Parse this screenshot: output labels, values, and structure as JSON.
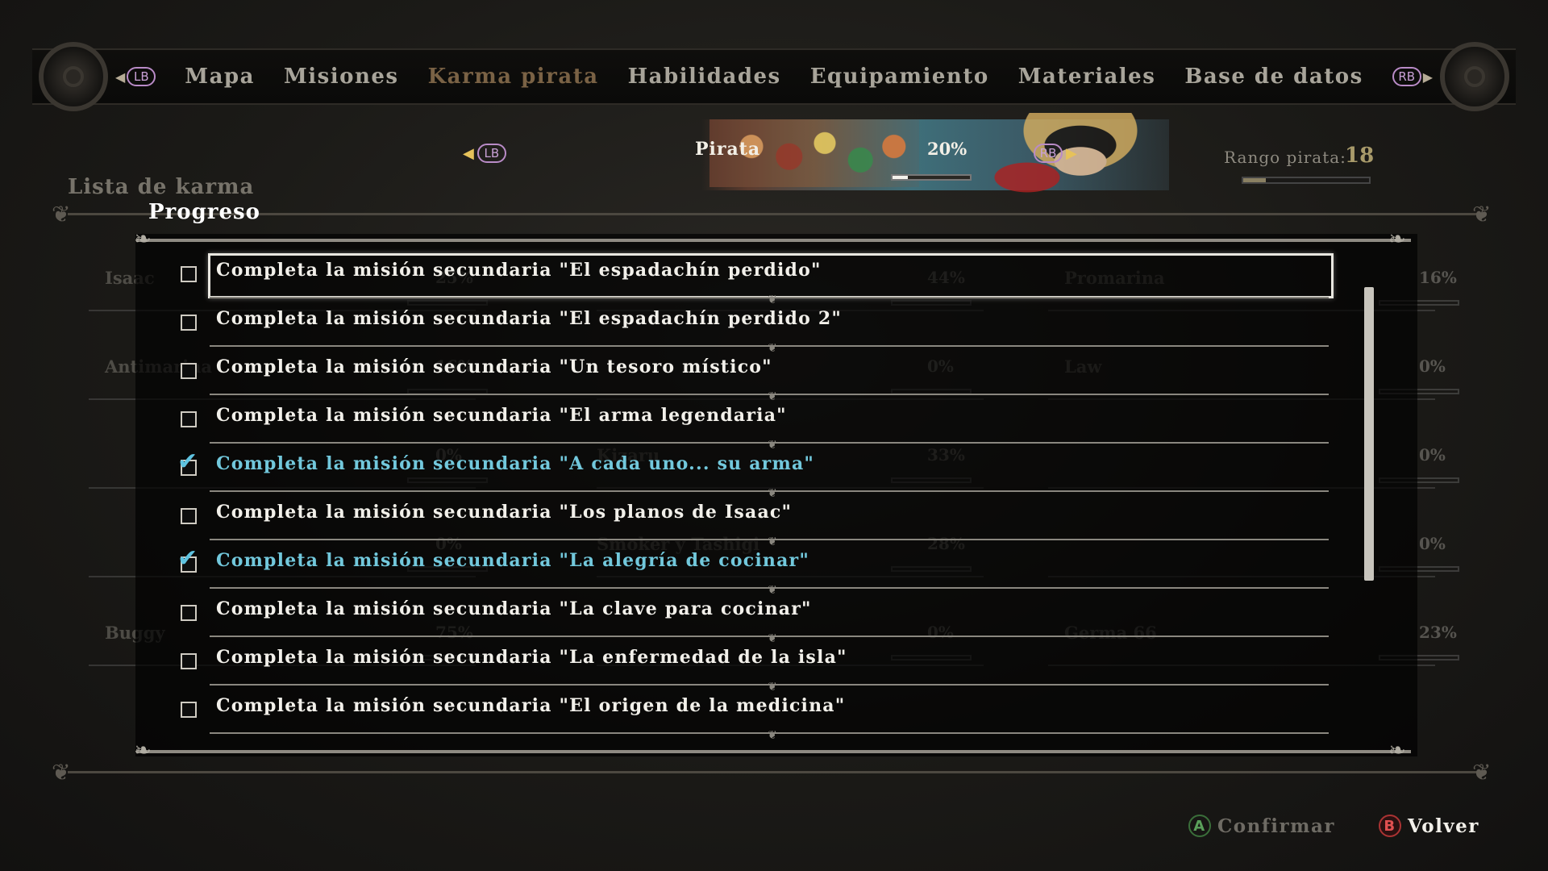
{
  "top_nav": {
    "left_button": "LB",
    "right_button": "RB",
    "tabs": [
      {
        "label": "Mapa",
        "active": false
      },
      {
        "label": "Misiones",
        "active": false
      },
      {
        "label": "Karma pirata",
        "active": true
      },
      {
        "label": "Habilidades",
        "active": false
      },
      {
        "label": "Equipamiento",
        "active": false
      },
      {
        "label": "Materiales",
        "active": false
      },
      {
        "label": "Base de datos",
        "active": false
      }
    ]
  },
  "category": {
    "prev_button": "LB",
    "next_button": "RB",
    "name": "Pirata",
    "percent": "20%",
    "progress": 0.2
  },
  "rank": {
    "label": "Rango pirata:",
    "value": "18",
    "progress": 0.18
  },
  "list_title": "Lista de karma",
  "background_grid": [
    {
      "name": "Isaac",
      "percent": "25%"
    },
    {
      "name": "",
      "percent": "44%"
    },
    {
      "name": "Promarina",
      "percent": "16%"
    },
    {
      "name": "Antimarina",
      "percent": "16%"
    },
    {
      "name": "",
      "percent": "0%"
    },
    {
      "name": "Law",
      "percent": "0%"
    },
    {
      "name": "",
      "percent": "0%"
    },
    {
      "name": "Kizaru",
      "percent": "33%"
    },
    {
      "name": "",
      "percent": "0%"
    },
    {
      "name": "",
      "percent": "0%"
    },
    {
      "name": "Smoker y Tashigi",
      "percent": "28%"
    },
    {
      "name": "",
      "percent": "0%"
    },
    {
      "name": "Buggy",
      "percent": "75%"
    },
    {
      "name": "",
      "percent": "0%"
    },
    {
      "name": "Germa 66",
      "percent": "23%"
    }
  ],
  "progress": {
    "title": "Progreso",
    "missions": [
      {
        "text": "Completa la misión secundaria \"El espadachín perdido\"",
        "done": false,
        "selected": true
      },
      {
        "text": "Completa la misión secundaria \"El espadachín perdido 2\"",
        "done": false,
        "selected": false
      },
      {
        "text": "Completa la misión secundaria \"Un tesoro místico\"",
        "done": false,
        "selected": false
      },
      {
        "text": "Completa la misión secundaria \"El arma legendaria\"",
        "done": false,
        "selected": false
      },
      {
        "text": "Completa la misión secundaria \"A cada uno... su arma\"",
        "done": true,
        "selected": false
      },
      {
        "text": "Completa la misión secundaria \"Los planos de Isaac\"",
        "done": false,
        "selected": false
      },
      {
        "text": "Completa la misión secundaria \"La alegría de cocinar\"",
        "done": true,
        "selected": false
      },
      {
        "text": "Completa la misión secundaria \"La clave para cocinar\"",
        "done": false,
        "selected": false
      },
      {
        "text": "Completa la misión secundaria \"La enfermedad de la isla\"",
        "done": false,
        "selected": false
      },
      {
        "text": "Completa la misión secundaria \"El origen de la medicina\"",
        "done": false,
        "selected": false
      }
    ]
  },
  "footer": {
    "confirm_button": "A",
    "confirm_label": "Confirmar",
    "back_button": "B",
    "back_label": "Volver"
  },
  "colors": {
    "completed_text": "#72c8dc",
    "active_tab": "#7a6245",
    "rank_value": "#a89a6a"
  }
}
